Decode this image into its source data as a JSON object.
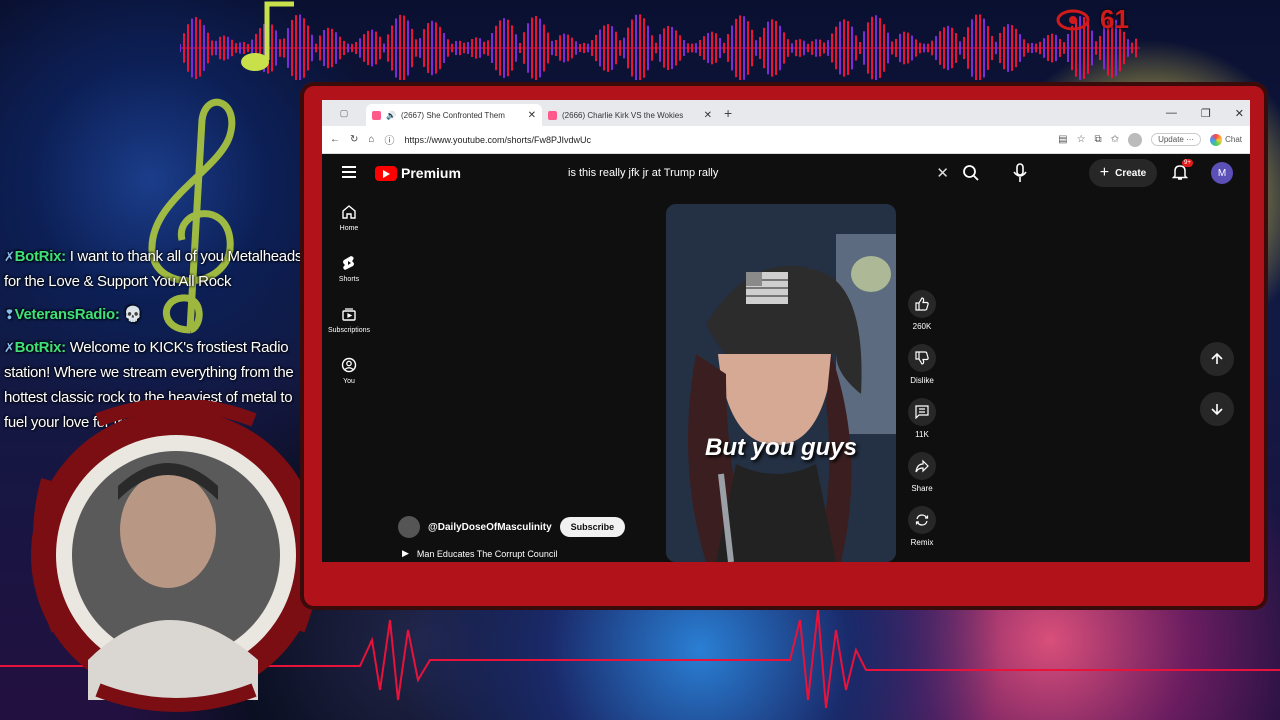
{
  "overlay": {
    "viewer_count": "61",
    "chat": [
      {
        "user": "BotRix:",
        "text": " I want to thank all of you Metalheads for the Love & Support You All Rock"
      },
      {
        "user": "VeteransRadio:",
        "text": " 💀"
      },
      {
        "user": "BotRix:",
        "text": " Welcome to KICK's frostiest Radio station! Where we stream everything from the hottest classic rock to the heaviest of metal to fuel your love for frosty tunes!"
      }
    ]
  },
  "browser": {
    "tabs": [
      {
        "title": "(2667) She Confronted Them"
      },
      {
        "title": "(2666) Charlie Kirk VS the Wokies"
      }
    ],
    "url": "https://www.youtube.com/shorts/Fw8PJIvdwUc",
    "update_label": "Update",
    "chat_label": "Chat"
  },
  "youtube": {
    "brand": "Premium",
    "search_query": "is this really jfk jr at Trump rally",
    "create_label": "Create",
    "notification_badge": "9+",
    "account_initial": "M",
    "sidebar": [
      {
        "label": "Home",
        "icon": "home-icon"
      },
      {
        "label": "Shorts",
        "icon": "shorts-icon"
      },
      {
        "label": "Subscriptions",
        "icon": "subscriptions-icon"
      },
      {
        "label": "You",
        "icon": "you-icon"
      }
    ],
    "short": {
      "caption": "But you guys",
      "channel": "@DailyDoseOfMasculinity",
      "subscribe_label": "Subscribe",
      "title": "Man Educates The Corrupt Council"
    },
    "actions": {
      "like_count": "260K",
      "dislike_label": "Dislike",
      "comment_count": "11K",
      "share_label": "Share",
      "remix_label": "Remix"
    }
  }
}
